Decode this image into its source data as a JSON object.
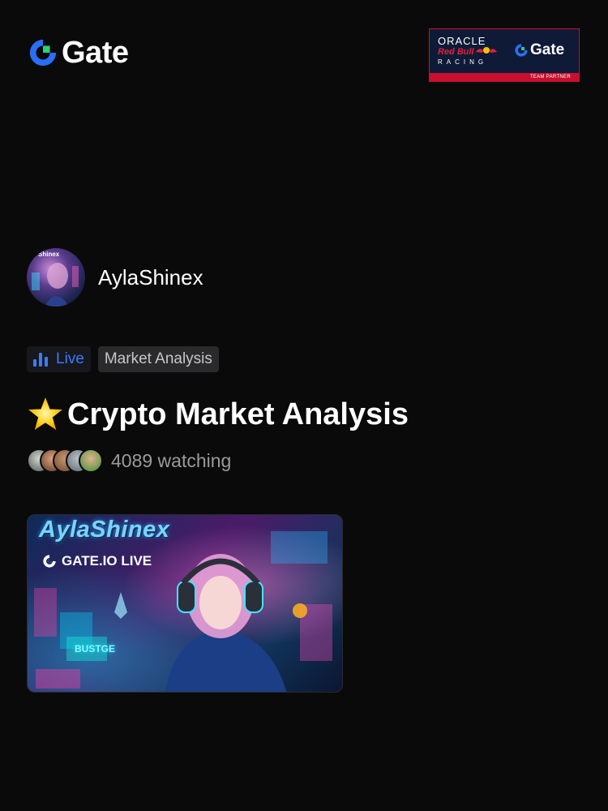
{
  "header": {
    "brand_name": "Gate",
    "brand_icon": "gate-logo-icon",
    "partner": {
      "oracle": "ORACLE",
      "redbull": "Red Bull",
      "racing": "RACING",
      "brand": "Gate",
      "strip": "TEAM PARTNER"
    }
  },
  "host": {
    "name": "AylaShinex",
    "avatar_text": "Shinex"
  },
  "tags": {
    "live_label": "Live",
    "category": "Market Analysis"
  },
  "stream": {
    "title_emoji": "star-icon",
    "title": "Crypto Market Analysis",
    "watching": "4089 watching"
  },
  "thumbnail": {
    "name": "AylaShinex",
    "badge": "GATE.IO LIVE"
  },
  "colors": {
    "background": "#0a0a0b",
    "accent_blue": "#3b7bf6",
    "tag_bg": "#2a2a2d",
    "partner_navy": "#0f1a37",
    "partner_red": "#c8102e"
  }
}
